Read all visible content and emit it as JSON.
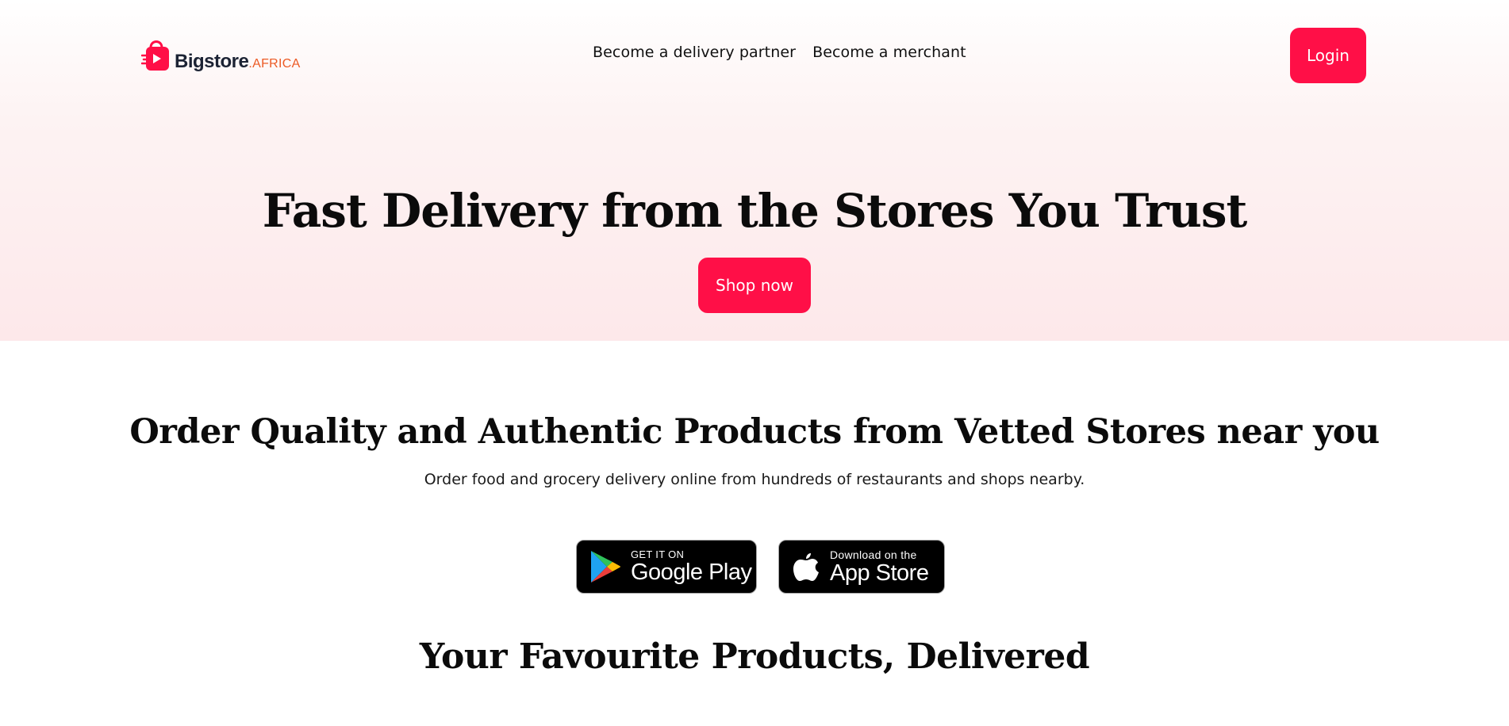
{
  "brand": {
    "name": "Bigstore",
    "tld": ".AFRICA",
    "logo_icon": "shopping-bag-icon",
    "accent_color": "#ff0f47",
    "tld_color": "#ec5a24"
  },
  "nav": {
    "items": [
      {
        "label": "Become a delivery partner"
      },
      {
        "label": "Become a merchant"
      }
    ],
    "login_label": "Login"
  },
  "hero": {
    "title": "Fast Delivery from the Stores You Trust",
    "cta_label": "Shop now"
  },
  "intro": {
    "title": "Order Quality and Authentic Products from Vetted Stores near you",
    "subtitle": "Order food and grocery delivery online from hundreds of restaurants and shops nearby."
  },
  "badges": {
    "google_play": {
      "small": "GET IT ON",
      "big": "Google Play",
      "icon": "google-play-icon"
    },
    "app_store": {
      "small": "Download on the",
      "big": "App Store",
      "icon": "apple-icon"
    }
  },
  "products": {
    "title": "Your Favourite Products, Delivered"
  }
}
